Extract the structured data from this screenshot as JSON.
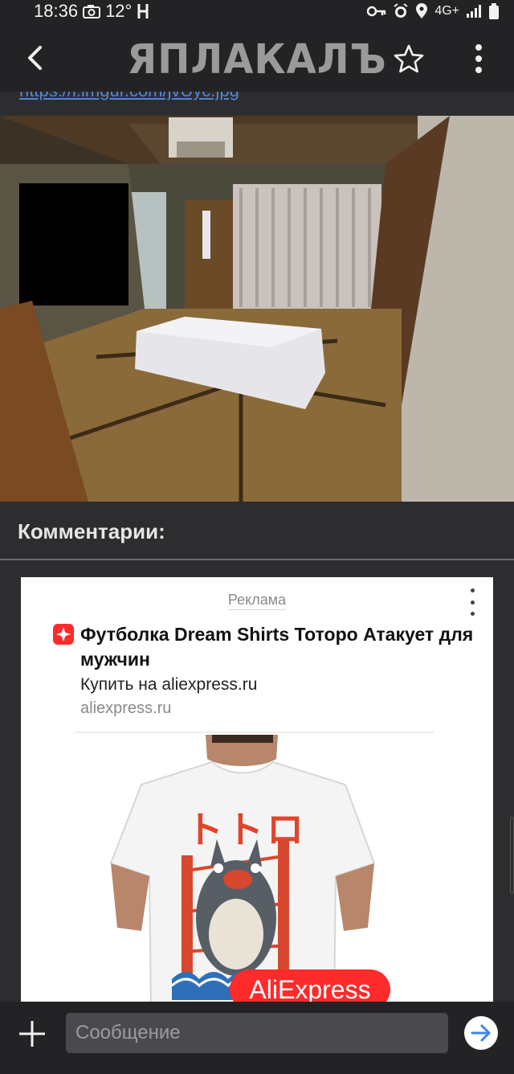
{
  "status_bar": {
    "time": "18:36",
    "temp": "12°",
    "network": "4G+",
    "icons": [
      "camera-icon",
      "h-icon",
      "key-icon",
      "alarm-icon",
      "location-icon",
      "signal-icon",
      "battery-icon"
    ]
  },
  "app_bar": {
    "logo": "ЯПЛАКАЛЪ",
    "icons": [
      "back-arrow-icon",
      "star-icon",
      "more-vert-icon"
    ]
  },
  "post": {
    "partial_link": "https://i.imgur.com/jvUyc.jpg",
    "image_alt": "room-photo"
  },
  "comments": {
    "header": "Комментарии:"
  },
  "ad": {
    "label": "Реклама",
    "title": "Футболка Dream Shirts Тоторо Атакует для мужчин",
    "subtitle": "Купить на aliexpress.ru",
    "domain": "aliexpress.ru",
    "badge": "AliExpress",
    "shirt_text": "トトロ",
    "brand_color": "#ff2a2a"
  },
  "composer": {
    "placeholder": "Сообщение"
  },
  "colors": {
    "bar_bg": "#232325",
    "content_bg": "#2d2d2f",
    "send_arrow": "#3e86e8",
    "link": "#4f86d9"
  }
}
